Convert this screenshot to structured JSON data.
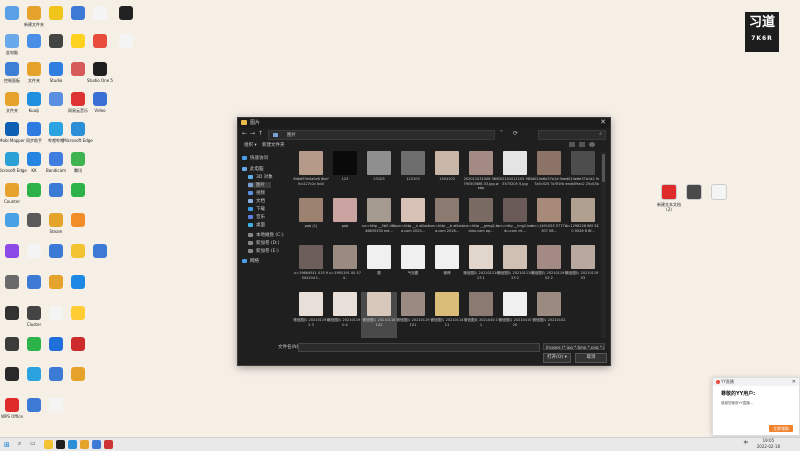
{
  "brand": {
    "line1": "习道",
    "line2": "7K6R"
  },
  "desktop_icons": [
    {
      "label": "",
      "color": "#5aa0e6"
    },
    {
      "label": "新建文件夹",
      "color": "#e6a32b"
    },
    {
      "label": "",
      "color": "#f0c419"
    },
    {
      "label": "",
      "color": "#3d7ad6"
    },
    {
      "label": "",
      "color": "#f4f4f4"
    },
    {
      "label": "",
      "color": "#222"
    },
    {
      "label": "此电脑",
      "color": "#6aa9e9"
    },
    {
      "label": "",
      "color": "#4a8fe7"
    },
    {
      "label": "",
      "color": "#444"
    },
    {
      "label": "",
      "color": "#ffd21f"
    },
    {
      "label": "",
      "color": "#e74c3c"
    },
    {
      "label": "",
      "color": "#f4f4f4"
    },
    {
      "label": "控制面板",
      "color": "#3c7fd5"
    },
    {
      "label": "文件夹",
      "color": "#e6a32b"
    },
    {
      "label": "Studio",
      "color": "#2f7ee0"
    },
    {
      "label": "",
      "color": "#d65a5a"
    },
    {
      "label": "Studio One 5",
      "color": "#1f1f1f"
    },
    {
      "label": "文件夹",
      "color": "#e6a32b"
    },
    {
      "label": "Kuaiji",
      "color": "#1f8fe0"
    },
    {
      "label": "",
      "color": "#5a8ee0"
    },
    {
      "label": "网易云音乐",
      "color": "#d33"
    },
    {
      "label": "Video",
      "color": "#3b6fd5"
    },
    {
      "label": "Mobi Mapper",
      "color": "#0d5fb3"
    },
    {
      "label": "同步助手",
      "color": "#2d7be0"
    },
    {
      "label": "哔哩哔哩",
      "color": "#2ba3e0"
    },
    {
      "label": "Microsoft Edge",
      "color": "#2a8fd6"
    },
    {
      "label": "Microsoft Edge",
      "color": "#2aa0d6"
    },
    {
      "label": "KK",
      "color": "#2585e0"
    },
    {
      "label": "Bandicam",
      "color": "#3f7de0"
    },
    {
      "label": "腾讯",
      "color": "#3fb34f"
    },
    {
      "label": "Counter",
      "color": "#e6a32b"
    },
    {
      "label": "",
      "color": "#2bb34a"
    },
    {
      "label": "",
      "color": "#3b7bd5"
    },
    {
      "label": "",
      "color": "#2bb34a"
    },
    {
      "label": "",
      "color": "#4aa0e6"
    },
    {
      "label": "",
      "color": "#5a5a5a"
    },
    {
      "label": "Steam",
      "color": "#e6a32b"
    },
    {
      "label": "",
      "color": "#f28c28"
    },
    {
      "label": "",
      "color": "#8b4ae6"
    },
    {
      "label": "",
      "color": "#f4f4f4"
    },
    {
      "label": "",
      "color": "#3d7ad6"
    },
    {
      "label": "",
      "color": "#f2c230"
    },
    {
      "label": "",
      "color": "#3d7ad6"
    },
    {
      "label": "",
      "color": "#6a6a6a"
    },
    {
      "label": "",
      "color": "#3d7ad6"
    },
    {
      "label": "",
      "color": "#e6a32b"
    },
    {
      "label": "",
      "color": "#1e88e5"
    },
    {
      "label": "",
      "color": "#333"
    },
    {
      "label": "Cluster",
      "color": "#444"
    },
    {
      "label": "",
      "color": "#f4f4f4"
    },
    {
      "label": "",
      "color": "#ffcc33"
    },
    {
      "label": "",
      "color": "#3c3c3c"
    },
    {
      "label": "",
      "color": "#2bb34a"
    },
    {
      "label": "",
      "color": "#1e6fd9"
    },
    {
      "label": "",
      "color": "#cc2b2b"
    },
    {
      "label": "",
      "color": "#2a2a2a"
    },
    {
      "label": "",
      "color": "#2ba3e0"
    },
    {
      "label": "",
      "color": "#3d7ad6"
    },
    {
      "label": "",
      "color": "#e6a32b"
    },
    {
      "label": "WPS Office",
      "color": "#e02b2b"
    },
    {
      "label": "",
      "color": "#3d7ad6"
    },
    {
      "label": "",
      "color": "#f4f4f4"
    }
  ],
  "dialog": {
    "title": "图片",
    "breadcrumb": "图片",
    "toolbar": {
      "organize": "组织 ▾",
      "new_folder": "新建文件夹"
    },
    "nav_items": [
      {
        "label": "快速访问",
        "color": "#4a9ee8"
      },
      {
        "label": "此电脑",
        "color": "#6aa9e9"
      },
      {
        "label": "3D 对象",
        "color": "#5ab0e8"
      },
      {
        "label": "图片",
        "color": "#7a9fd6",
        "selected": true
      },
      {
        "label": "视频",
        "color": "#5a8fe0"
      },
      {
        "label": "文档",
        "color": "#8ab0e0"
      },
      {
        "label": "下载",
        "color": "#3d9be6"
      },
      {
        "label": "音乐",
        "color": "#5a7fe0"
      },
      {
        "label": "桌面",
        "color": "#3fb0e6"
      },
      {
        "label": "本地磁盘 (C:)",
        "color": "#888"
      },
      {
        "label": "新加卷 (D:)",
        "color": "#888"
      },
      {
        "label": "新加卷 (E:)",
        "color": "#888"
      },
      {
        "label": "网络",
        "color": "#4a9ee8"
      }
    ],
    "files": [
      {
        "name": "6dbd93e0a0e6 6bcffcc227c2c bd4",
        "color": "#b59a8a"
      },
      {
        "name": "123",
        "color": "#0a0a0a"
      },
      {
        "name": "23103",
        "color": "#8f8f8f"
      },
      {
        "name": "123103",
        "color": "#6e6e6e"
      },
      {
        "name": "1304103",
        "color": "#c9b6a6"
      },
      {
        "name": "202011031008 5897905058f8 03.jpg.webp",
        "color": "#a38a84"
      },
      {
        "name": "202101011105 9855570205 5.jpg",
        "color": "#e4e4e4"
      },
      {
        "name": "d024e6e37a1d 9ae7a5c525 3c3f1fb",
        "color": "#8b7465"
      },
      {
        "name": "d024e6e37a1d2 9aeeda59ac2 25c03bc",
        "color": "#4d4d4d"
      },
      {
        "name": "pob (1)",
        "color": "#9b8270"
      },
      {
        "name": "pob",
        "color": "#c9a4a0"
      },
      {
        "name": "src=http __5b0 d8b46635250 ext...",
        "color": "#a59a90"
      },
      {
        "name": "src=http __n alibaba.com 2020...",
        "color": "#d8c2b8"
      },
      {
        "name": "src=http __b alibaba.com 2018...",
        "color": "#8a7a70"
      },
      {
        "name": "src=http __gimg2.baidu.com ap...",
        "color": "#7a6a64"
      },
      {
        "name": "src=http __img2.baidu.com cit...",
        "color": "#6a5a58"
      },
      {
        "name": "src=1491055 57774307 08...",
        "color": "#a88a7a"
      },
      {
        "name": "u=1298228 68f 3420 0026 8 8f...",
        "color": "#b0a090"
      },
      {
        "name": "u=19664911 015 9504104 f...",
        "color": "#6e5e5a"
      },
      {
        "name": "u=1992191 00 57 4..",
        "color": "#9a8a80"
      },
      {
        "name": "图",
        "color": "#f0f0f0"
      },
      {
        "name": "气泡图",
        "color": "#f0f0f0"
      },
      {
        "name": "微博",
        "color": "#f0f0f0"
      },
      {
        "name": "微信图片 20210111023 1",
        "color": "#e0d6ce"
      },
      {
        "name": "微信图片 20210111023 2",
        "color": "#d0c0b4"
      },
      {
        "name": "微信图片 20210119102 2",
        "color": "#a38a84"
      },
      {
        "name": "微信图片 20210119103",
        "color": "#b8a8a0"
      },
      {
        "name": "微信图片 2021011912 3",
        "color": "#e8e0d8"
      },
      {
        "name": "微信图片 2021011910 4",
        "color": "#e8e0d8"
      },
      {
        "name": "微信图片 20210118 102",
        "color": "#d8c8bc",
        "selected": true
      },
      {
        "name": "微信图片 20210119 101",
        "color": "#9a8a82"
      },
      {
        "name": "微信图片 20210114 11",
        "color": "#d8bc78"
      },
      {
        "name": "微信图片 2021040 11",
        "color": "#8a7a72"
      },
      {
        "name": "微信图片 20210410 20",
        "color": "#f0f0f0"
      },
      {
        "name": "微信图片 20210102 5",
        "color": "#9a8a80"
      }
    ],
    "filename_label": "文件名(N):",
    "filename_value": "",
    "filetype": "Images (*.jpg *.bmp *.png *.j...",
    "open_button": "打开(O) ▾",
    "cancel_button": "取消"
  },
  "right_desktop_icons": [
    {
      "label": "新建文本文档 (2)",
      "color": "#e02b2b"
    },
    {
      "label": "",
      "color": "#4a4a4a"
    },
    {
      "label": "",
      "color": "#f4f4f4"
    }
  ],
  "notification": {
    "app": "YY直播",
    "greeting": "尊敬的YY用户:",
    "message": "感谢您使用YY直播...",
    "claim": "立即领取"
  },
  "taskbar": {
    "time": "19:05",
    "date": "2022-02-18",
    "lang": "中",
    "apps": [
      {
        "color": "#f2c230"
      },
      {
        "color": "#1e1e1e"
      },
      {
        "color": "#2a8fd6"
      },
      {
        "color": "#e6a32b"
      },
      {
        "color": "#3d7ad6"
      },
      {
        "color": "#cc3333"
      }
    ]
  }
}
